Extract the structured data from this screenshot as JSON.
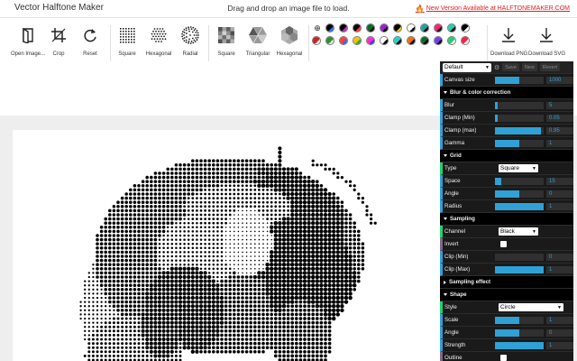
{
  "header": {
    "app_title": "Vector Halftone Maker",
    "drop_hint": "Drag and drop an image file to load.",
    "new_version": "New Version Available at HALFTONEMAKER.COM"
  },
  "toolbar": {
    "file_tools": [
      {
        "label": "Open Image...",
        "icon": "open-image-icon"
      },
      {
        "label": "Crop",
        "icon": "crop-icon"
      },
      {
        "label": "Reset",
        "icon": "reset-icon"
      }
    ],
    "grid_types": [
      {
        "label": "Square",
        "icon": "square-grid-icon"
      },
      {
        "label": "Hexagonal",
        "icon": "hexagonal-grid-icon"
      },
      {
        "label": "Radial",
        "icon": "radial-grid-icon"
      }
    ],
    "shape_types": [
      {
        "label": "Square",
        "icon": "square-shape-icon"
      },
      {
        "label": "Triangular",
        "icon": "triangular-shape-icon"
      },
      {
        "label": "Hexagonal",
        "icon": "hexagonal-shape-icon"
      }
    ],
    "download": [
      {
        "label": "Download PNG",
        "icon": "download-icon"
      },
      {
        "label": "Download SVG",
        "icon": "download-icon"
      }
    ],
    "swatches": [
      [
        "#000000",
        "#2b6cff"
      ],
      [
        "#000000",
        "#d21fd2"
      ],
      [
        "#000000",
        "#ff3b3b"
      ],
      [
        "#0a6b2a",
        "#000000"
      ],
      [
        "#9b1fd2",
        "#000000"
      ],
      [
        "#000000",
        "#f2c200"
      ],
      [
        "#ffffff",
        "#000000"
      ],
      [
        "#1aa5a5",
        "#000000"
      ],
      [
        "#ff1f7a",
        "#000000"
      ],
      [
        "#1fd2b0",
        "#000000"
      ],
      [
        "#000000",
        "#ffffff"
      ],
      [
        "#d21f1f",
        "#ffffff"
      ],
      [
        "#2f8f2f",
        "#e0e0e0"
      ],
      [
        "#ff3b3b",
        "#2b6cff"
      ],
      [
        "#f2c200",
        "#1fb03a"
      ],
      [
        "#ff2bd2",
        "#2b3bff"
      ],
      [
        "#ffffff",
        "#000000"
      ],
      [
        "#1fd2d2",
        "#000000"
      ],
      [
        "#ff6a00",
        "#000000"
      ],
      [
        "#0a6b2a",
        "#000000"
      ],
      [
        "#7a3bff",
        "#000000"
      ],
      [
        "#1fd26f",
        "#ffffff"
      ],
      [
        "#ff1f4a",
        "#ffffff"
      ]
    ]
  },
  "panel": {
    "preset": "Default",
    "preset_buttons": [
      "Save",
      "New",
      "Revert"
    ],
    "canvas_size": {
      "label": "Canvas size",
      "value": "1000",
      "fill": 0.5
    },
    "blur_folder": "Blur & color correction",
    "blur": [
      {
        "label": "Blur",
        "value": "5",
        "fill": 0.05
      },
      {
        "label": "Clamp (Min)",
        "value": "0.05",
        "fill": 0.05
      },
      {
        "label": "Clamp (max)",
        "value": "0.95",
        "fill": 0.95
      },
      {
        "label": "Gamma",
        "value": "1",
        "fill": 0.5
      }
    ],
    "grid_folder": "Grid",
    "grid_type": {
      "label": "Type",
      "value": "Square"
    },
    "grid": [
      {
        "label": "Space",
        "value": "15",
        "fill": 0.13
      },
      {
        "label": "Angle",
        "value": "0",
        "fill": 0.5
      },
      {
        "label": "Radius",
        "value": "1",
        "fill": 1.0
      }
    ],
    "sampling_folder": "Sampling",
    "channel": {
      "label": "Channel",
      "value": "Black"
    },
    "invert": {
      "label": "Invert"
    },
    "sampling": [
      {
        "label": "Clip (Min)",
        "value": "0",
        "fill": 0.0
      },
      {
        "label": "Clip (Max)",
        "value": "1",
        "fill": 1.0
      }
    ],
    "sampling_effect_folder": "Sampling effect",
    "shape_folder": "Shape",
    "style": {
      "label": "Style",
      "value": "Circle"
    },
    "shape": [
      {
        "label": "Scale",
        "value": "1",
        "fill": 0.5
      },
      {
        "label": "Angle",
        "value": "0",
        "fill": 0.5
      },
      {
        "label": "Strength",
        "value": "1",
        "fill": 1.0
      }
    ],
    "outline": {
      "label": "Outline"
    }
  }
}
